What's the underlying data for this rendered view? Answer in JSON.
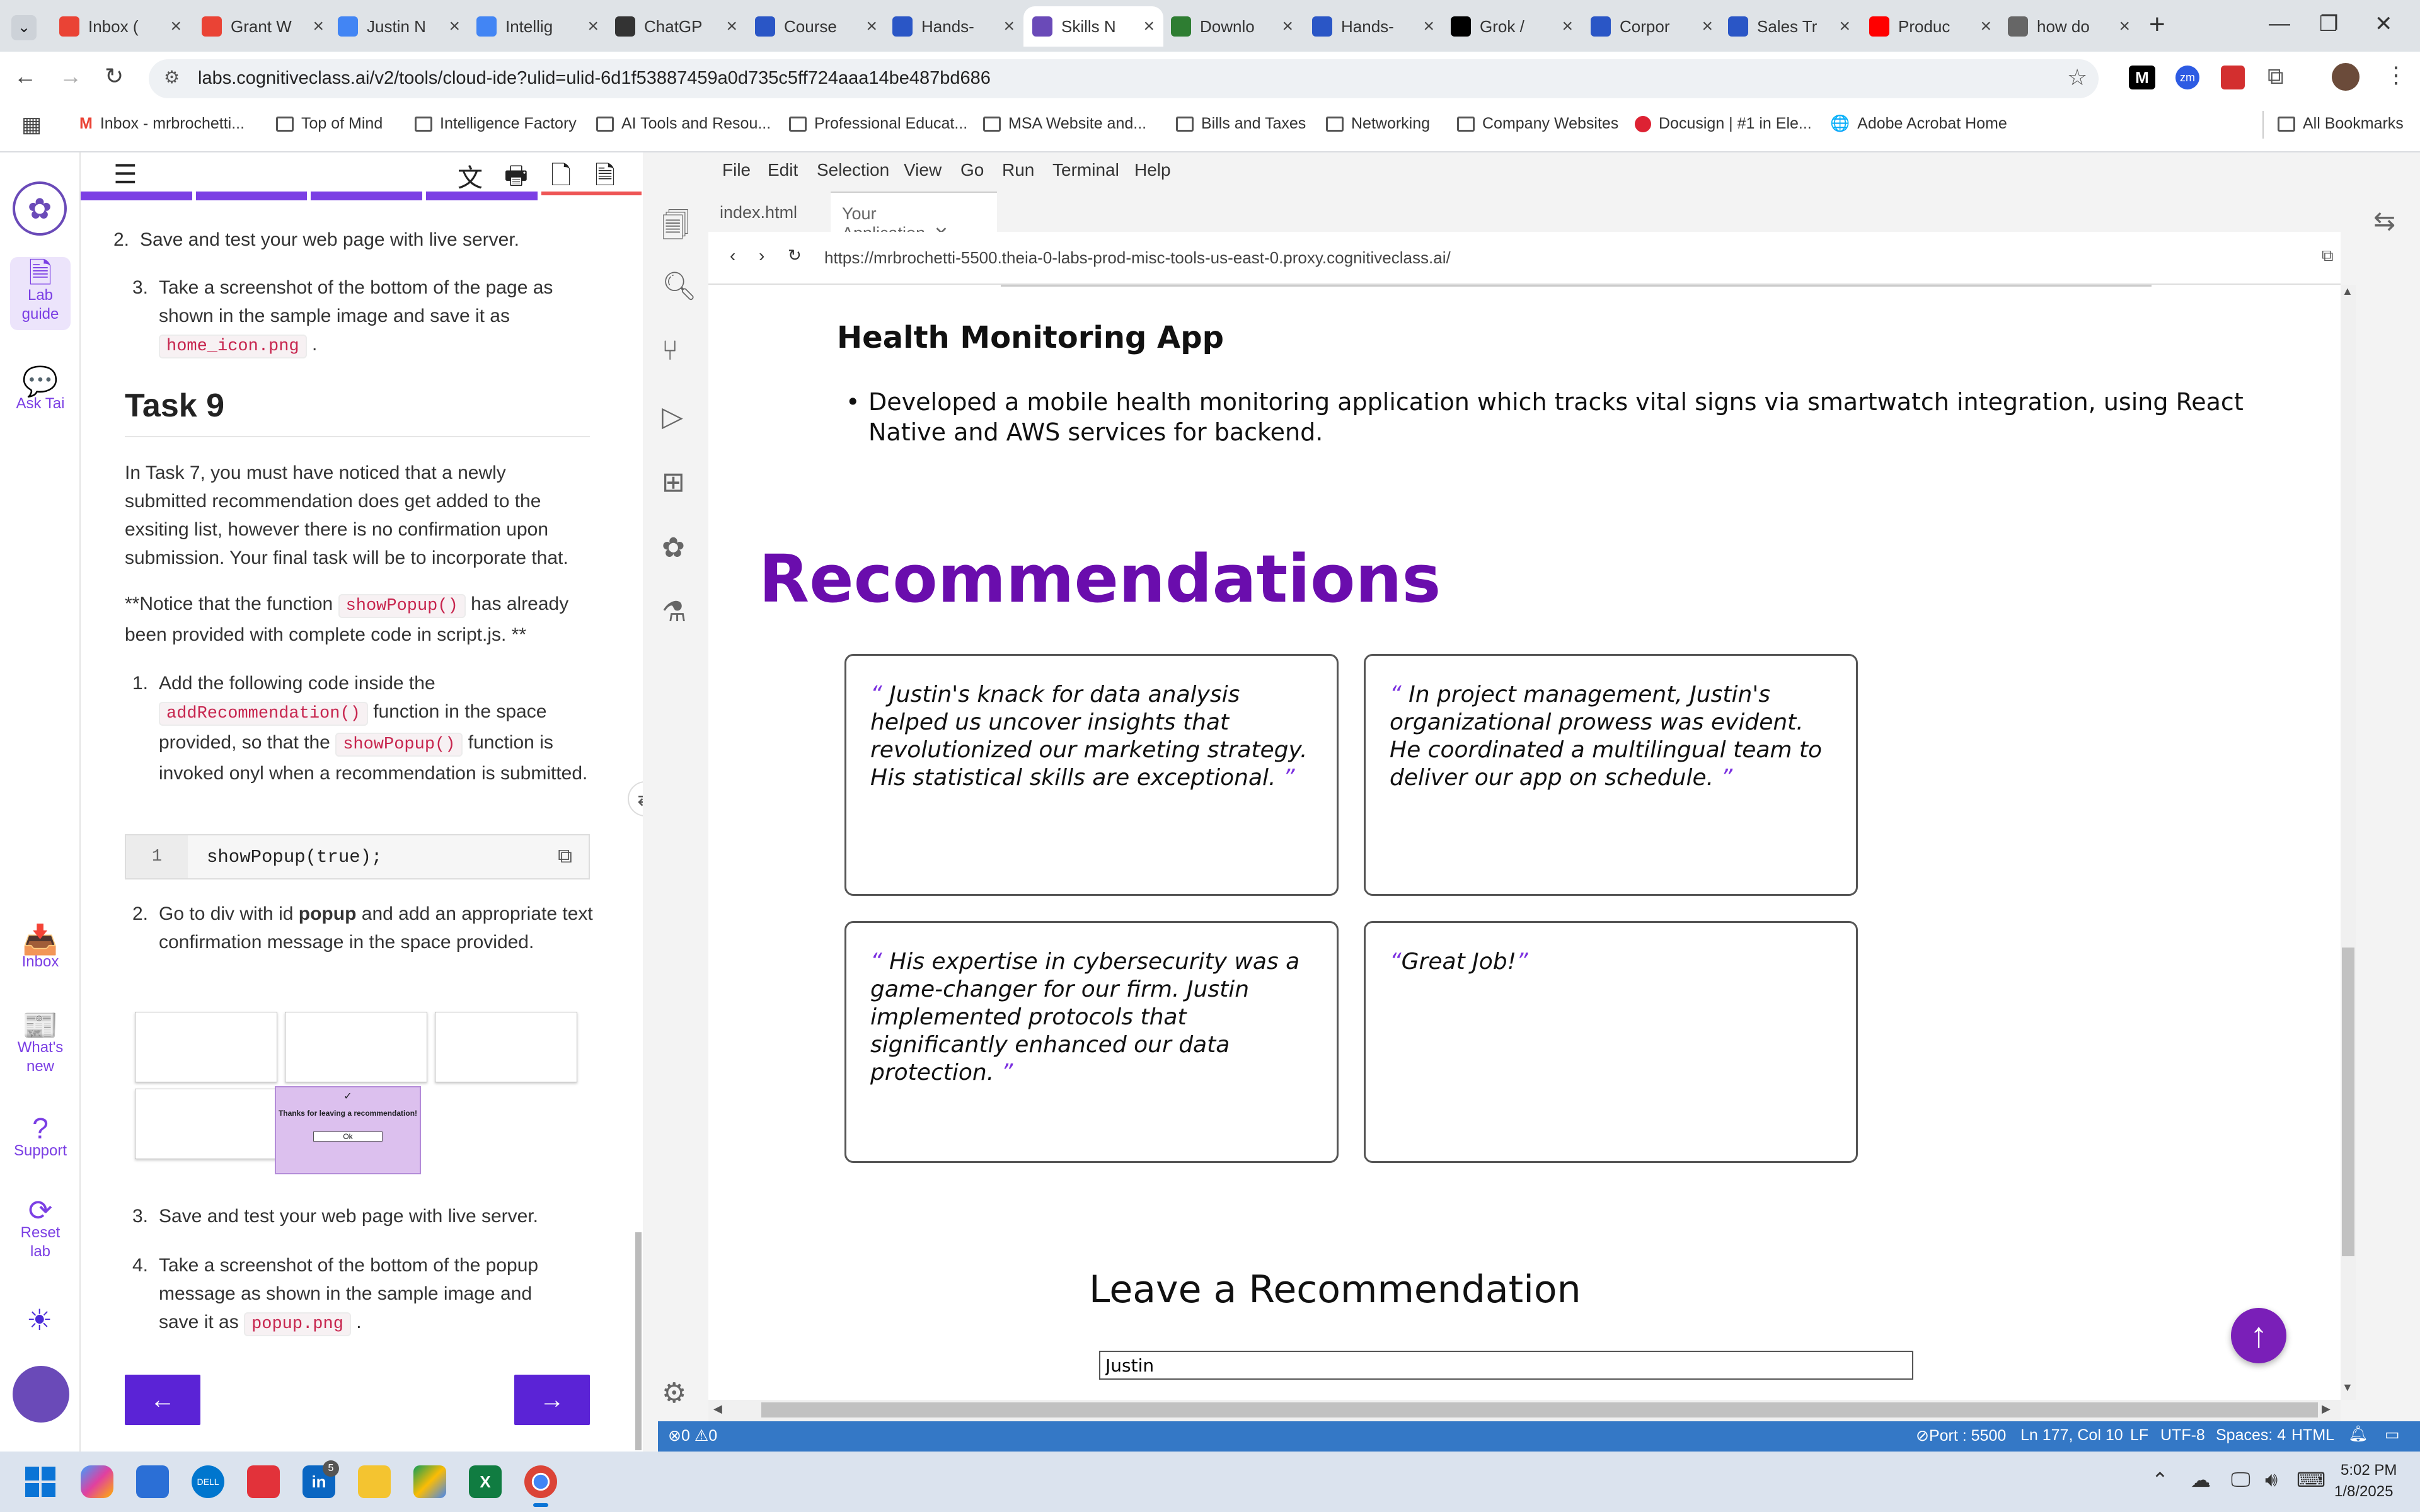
{
  "browser": {
    "tabs": [
      {
        "title": "Inbox (",
        "icon": "gmail-icon",
        "color": "#ea4335"
      },
      {
        "title": "Grant W",
        "icon": "gmail-icon",
        "color": "#ea4335"
      },
      {
        "title": "Justin N",
        "icon": "docs-icon",
        "color": "#4285f4"
      },
      {
        "title": "Intellig",
        "icon": "docs-icon",
        "color": "#4285f4"
      },
      {
        "title": "ChatGP",
        "icon": "chatgpt-icon",
        "color": "#333333"
      },
      {
        "title": "Course",
        "icon": "coursera-icon",
        "color": "#2a56c6"
      },
      {
        "title": "Hands-",
        "icon": "coursera-icon",
        "color": "#2a56c6"
      },
      {
        "title": "Skills N",
        "icon": "skills-icon",
        "color": "#6a4ab8"
      },
      {
        "title": "Downlo",
        "icon": "px-icon",
        "color": "#2e7d32"
      },
      {
        "title": "Hands-",
        "icon": "coursera-icon",
        "color": "#2a56c6"
      },
      {
        "title": "Grok / ",
        "icon": "x-icon",
        "color": "#000000"
      },
      {
        "title": "Corpor",
        "icon": "coursera-icon",
        "color": "#2a56c6"
      },
      {
        "title": "Sales Tr",
        "icon": "coursera-icon",
        "color": "#2a56c6"
      },
      {
        "title": "Produc",
        "icon": "youtube-icon",
        "color": "#ff0000"
      },
      {
        "title": "how do",
        "icon": "globe-icon",
        "color": "#666666"
      }
    ],
    "url": "labs.cognitiveclass.ai/v2/tools/cloud-ide?ulid=ulid-6d1f53887459a0d735c5ff724aaa14be487bd686",
    "bookmarks": [
      "Inbox - mrbrochetti...",
      "Top of Mind",
      "Intelligence Factory",
      "AI Tools and Resou...",
      "Professional Educat...",
      "MSA Website and...",
      "Bills and Taxes",
      "Networking",
      "Company Websites",
      "Docusign | #1 in Ele...",
      "Adobe Acrobat Home"
    ],
    "all_bookmarks": "All Bookmarks"
  },
  "rail": {
    "lab_guide": "Lab guide",
    "ask_tai": "Ask Tai",
    "inbox": "Inbox",
    "whats_new": "What's new",
    "support": "Support",
    "reset_lab": "Reset lab"
  },
  "guide": {
    "item2_prev": "Save and test your web page with live server.",
    "item3_prev_a": "Take a screenshot of the bottom of the page as shown in the sample image and save it as",
    "item3_prev_code": "home_icon.png",
    "task_title": "Task 9",
    "para1": "In Task 7, you must have noticed that a newly submitted recommendation does get added to the exsiting list, however there is no confirmation upon submission. Your final task will be to incorporate that.",
    "para2_a": "**Notice that the function",
    "para2_code": "showPopup()",
    "para2_b": "has already been provided with complete code in script.js. **",
    "step1_a": "Add the following code inside the",
    "step1_code1": "addRecommendation()",
    "step1_b": "function in the space provided, so that the",
    "step1_code2": "showPopup()",
    "step1_c": "function is invoked onyl when a recommendation is submitted.",
    "code_line_no": "1",
    "code_line": "showPopup(true);",
    "step2_a": "Go to div with id",
    "step2_bold": "popup",
    "step2_b": "and add an appropriate text confirmation message in the space provided.",
    "sample_popup_text": "Thanks for leaving a recommendation!",
    "sample_ok": "Ok",
    "step3": "Save and test your web page with live server.",
    "step4_a": "Take a screenshot of the bottom of the popup message as shown in the sample image and save it as",
    "step4_code": "popup.png"
  },
  "ide": {
    "menu": [
      "File",
      "Edit",
      "Selection",
      "View",
      "Go",
      "Run",
      "Terminal",
      "Help"
    ],
    "tabs": [
      "index.html",
      "Your Application"
    ],
    "preview_url": "https://mrbrochetti-5500.theia-0-labs-prod-misc-tools-us-east-0.proxy.cognitiveclass.ai/",
    "status": {
      "errors": "0",
      "warnings": "0",
      "port": "Port : 5500",
      "position": "Ln 177, Col 10",
      "eol": "LF",
      "encoding": "UTF-8",
      "spaces": "Spaces: 4",
      "lang": "HTML"
    }
  },
  "app": {
    "project_title": "Health Monitoring App",
    "project_desc": "Developed a mobile health monitoring application which tracks vital signs via smartwatch integration, using React Native and AWS services for backend.",
    "rec_heading": "Recommendations",
    "recommendations": [
      "Justin's knack for data analysis helped us uncover insights that revolutionized our marketing strategy. His statistical skills are exceptional.",
      "In project management, Justin's organizational prowess was evident. He coordinated a multilingual team to deliver our app on schedule.",
      "His expertise in cybersecurity was a game-changer for our firm. Justin implemented protocols that significantly enhanced our data protection.",
      "Great Job!"
    ],
    "leave_heading": "Leave a Recommendation",
    "name_value": "Justin"
  },
  "taskbar": {
    "time": "5:02 PM",
    "date": "1/8/2025",
    "linkedin_badge": "5"
  },
  "colors": {
    "accent_purple": "#6a0dad",
    "status_blue": "#3478c6"
  }
}
